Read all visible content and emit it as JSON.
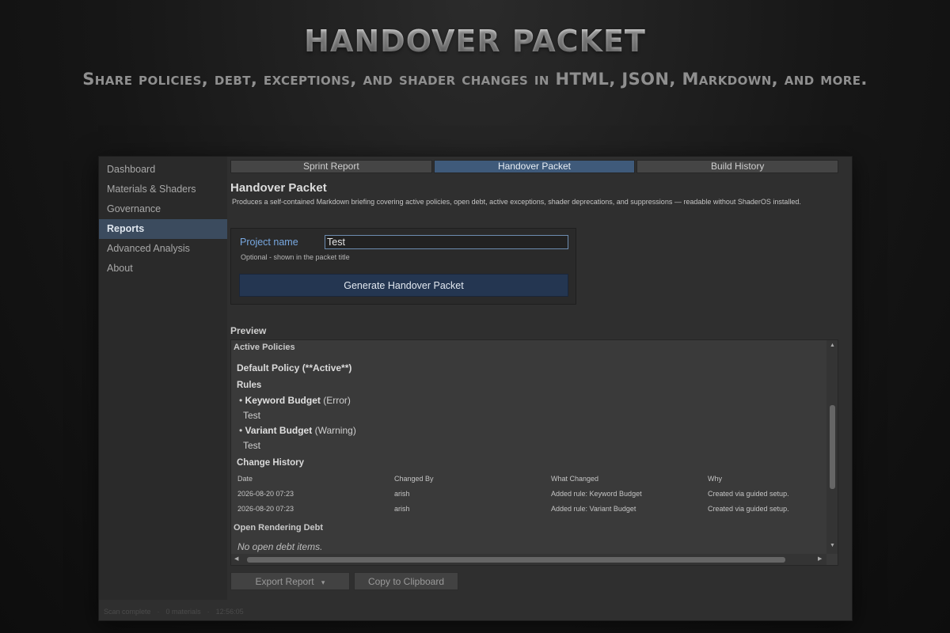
{
  "hero": {
    "title": "HANDOVER PACKET",
    "subtitle": "Share policies, debt, exceptions, and shader changes in HTML, JSON, Markdown, and more."
  },
  "sidebar": {
    "items": [
      {
        "label": "Dashboard"
      },
      {
        "label": "Materials & Shaders"
      },
      {
        "label": "Governance"
      },
      {
        "label": "Reports",
        "active": true
      },
      {
        "label": "Advanced Analysis"
      },
      {
        "label": "About"
      }
    ]
  },
  "tabs": [
    {
      "label": "Sprint Report"
    },
    {
      "label": "Handover Packet",
      "active": true
    },
    {
      "label": "Build History"
    }
  ],
  "page": {
    "title": "Handover Packet",
    "description": "Produces a self-contained Markdown briefing covering active policies, open debt, active exceptions, shader deprecations, and suppressions — readable without ShaderOS installed."
  },
  "form": {
    "project_label": "Project name",
    "project_value": "Test",
    "project_help": "Optional - shown in the packet title",
    "generate_label": "Generate Handover Packet"
  },
  "preview": {
    "label": "Preview",
    "section_active": "Active Policies",
    "policy_heading": "Default Policy (**Active**)",
    "rules_heading": "Rules",
    "rules": [
      {
        "name": "Keyword Budget",
        "severity": "(Error)",
        "desc": "Test"
      },
      {
        "name": "Variant Budget",
        "severity": "(Warning)",
        "desc": "Test"
      }
    ],
    "history_heading": "Change History",
    "history_columns": [
      "Date",
      "Changed By",
      "What Changed",
      "Why"
    ],
    "history_rows": [
      [
        "2026-08-20 07:23",
        "arish",
        "Added rule: Keyword Budget",
        "Created via guided setup."
      ],
      [
        "2026-08-20 07:23",
        "arish",
        "Added rule: Variant Budget",
        "Created via guided setup."
      ]
    ],
    "section_debt": "Open Rendering Debt",
    "debt_empty": "No open debt items."
  },
  "actions": {
    "export_label": "Export Report",
    "export_caret": "▾",
    "copy_label": "Copy to Clipboard"
  },
  "status": {
    "scan": "Scan complete",
    "sep": "·",
    "materials": "0 materials",
    "time": "12:56:05"
  }
}
